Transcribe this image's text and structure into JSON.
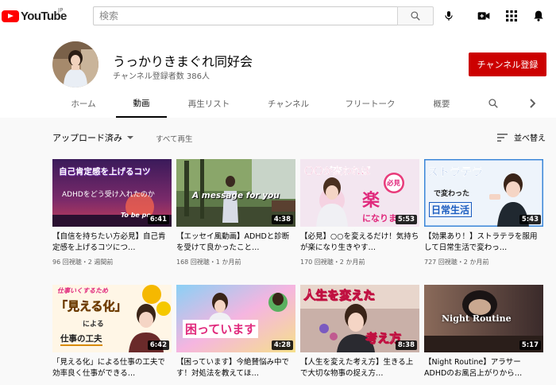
{
  "header": {
    "logo_text": "YouTube",
    "logo_region": "JP",
    "search_placeholder": "検索",
    "icons": [
      "search-icon",
      "microphone-icon",
      "create-video-icon",
      "apps-grid-icon",
      "notifications-bell-icon"
    ]
  },
  "channel": {
    "name": "うっかりきまぐれ同好会",
    "subscribers": "チャンネル登録者数 386人",
    "subscribe_label": "チャンネル登録",
    "tabs": [
      {
        "label": "ホーム"
      },
      {
        "label": "動画"
      },
      {
        "label": "再生リスト"
      },
      {
        "label": "チャンネル"
      },
      {
        "label": "フリートーク"
      },
      {
        "label": "概要"
      }
    ],
    "active_tab": "動画"
  },
  "filters": {
    "dropdown_label": "アップロード済み",
    "all_label": "すべて再生",
    "sort_label": "並べ替え"
  },
  "videos": [
    {
      "title": "【自信を持ちたい方必見】自己肯定感を上げるコツにつ…",
      "meta": "96 回視聴・2 週間前",
      "duration": "6:41",
      "thumb_texts": [
        "自己肯定感を上げるコツ",
        "ADHDをどう受け入れたのか",
        "To be po"
      ]
    },
    {
      "title": "【エッセイ風動画】ADHDと診断を受けて良かったこと…",
      "meta": "168 回視聴・1 か月前",
      "duration": "4:38",
      "thumb_texts": [
        "A message for you"
      ]
    },
    {
      "title": "【必見】○○を変えるだけ！気持ちが楽になり生きやす…",
      "meta": "170 回視聴・2 か月前",
      "duration": "5:53",
      "thumb_texts": [
        "〇〇が変われば",
        "必見",
        "楽",
        "になりま"
      ]
    },
    {
      "title": "【効果あり！】ストラテラを服用して日常生活で変わっ…",
      "meta": "727 回視聴・2 か月前",
      "duration": "5:43",
      "thumb_texts": [
        "ストラテラ",
        "で変わった",
        "日常生活"
      ]
    },
    {
      "title": "「見える化」による仕事の工夫で効率良く仕事ができる…",
      "meta": "",
      "duration": "6:42",
      "thumb_texts": [
        "仕事いくするため",
        "「見える化」",
        "による",
        "仕事の工夫"
      ]
    },
    {
      "title": "【困っています】今絶賛悩み中です！対処法を教えてほ…",
      "meta": "",
      "duration": "4:28",
      "thumb_texts": [
        "困っています"
      ]
    },
    {
      "title": "【人生を変えた考え方】生きる上で大切な物事の捉え方…",
      "meta": "",
      "duration": "8:38",
      "thumb_texts": [
        "人生を変えた",
        "考え方"
      ]
    },
    {
      "title": "【Night Routine】アラサーADHDのお風呂上がりから…",
      "meta": "",
      "duration": "5:17",
      "thumb_texts": [
        "Night Routine"
      ]
    }
  ],
  "colors": {
    "brand_red": "#ff0000",
    "subscribe_red": "#cc0000"
  }
}
